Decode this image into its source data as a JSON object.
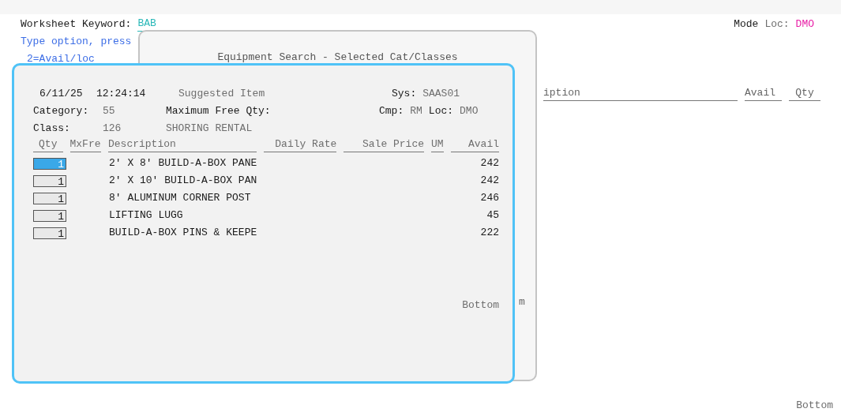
{
  "screen": {
    "keyword_label": "Worksheet Keyword:",
    "keyword_value": "BAB",
    "mode_label": "Mode",
    "loc_label": "Loc:",
    "loc_value": "DMO",
    "instruction": "Type option, press",
    "option": "2=Avail/loc",
    "columns": [
      "iption",
      "Avail",
      "Qty"
    ],
    "footer": "Bottom"
  },
  "back_window": {
    "title": "Equipment Search - Selected Cat/Classes",
    "partial_text": "m"
  },
  "dialog": {
    "date": "6/11/25",
    "time": "12:24:14",
    "heading": "Suggested Item",
    "sys_label": "Sys:",
    "sys_value": "SAAS01",
    "category_label": "Category:",
    "category_value": "55",
    "max_free_label": "Maximum Free Qty:",
    "cmp_label": "Cmp:",
    "cmp_value": "RM",
    "loc_label": "Loc:",
    "loc_value": "DMO",
    "class_label": "Class:",
    "class_value": "126",
    "class_name": "SHORING RENTAL",
    "columns": [
      "Qty",
      "MxFre",
      "Description",
      "Daily Rate",
      "Sale Price",
      "UM",
      "Avail"
    ],
    "rows": [
      {
        "qty": "1",
        "selected": true,
        "description": "2' X 8' BUILD-A-BOX PANE",
        "avail": "242"
      },
      {
        "qty": "1",
        "selected": false,
        "description": "2' X 10' BUILD-A-BOX PAN",
        "avail": "242"
      },
      {
        "qty": "1",
        "selected": false,
        "description": "8' ALUMINUM CORNER POST",
        "avail": "246"
      },
      {
        "qty": "1",
        "selected": false,
        "description": "LIFTING LUGG",
        "avail": "45"
      },
      {
        "qty": "1",
        "selected": false,
        "description": "BUILD-A-BOX PINS & KEEPE",
        "avail": "222"
      }
    ],
    "footer": "Bottom"
  }
}
